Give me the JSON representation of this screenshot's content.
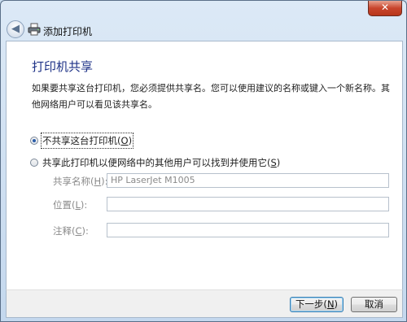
{
  "window": {
    "title": "添加打印机",
    "close_symbol": "✕"
  },
  "nav": {
    "back_symbol": "◀",
    "back_icon": "back-arrow-icon",
    "printer_icon": "printer-icon"
  },
  "page": {
    "title": "打印机共享",
    "description": "如果要共享这台打印机，您必须提供共享名。您可以使用建议的名称或键入一个新名称。其他网络用户可以看见该共享名。"
  },
  "options": {
    "no_share": {
      "label": "不共享这台打印机(",
      "key": "O",
      "suffix": ")",
      "checked": true
    },
    "share": {
      "label": "共享此打印机以便网络中的其他用户可以找到并使用它(",
      "key": "S",
      "suffix": ")",
      "checked": false
    }
  },
  "fields": {
    "share_name": {
      "label": "共享名称(",
      "key": "H",
      "suffix": "):",
      "value": "HP LaserJet M1005"
    },
    "location": {
      "label": "位置(",
      "key": "L",
      "suffix": "):",
      "value": ""
    },
    "comment": {
      "label": "注释(",
      "key": "C",
      "suffix": "):",
      "value": ""
    }
  },
  "buttons": {
    "next": {
      "label": "下一步(",
      "key": "N",
      "suffix": ")"
    },
    "cancel": {
      "label": "取消"
    }
  },
  "colors": {
    "title_blue": "#1e3287",
    "close_red": "#c8452c",
    "frame": "#c4d8ee"
  }
}
